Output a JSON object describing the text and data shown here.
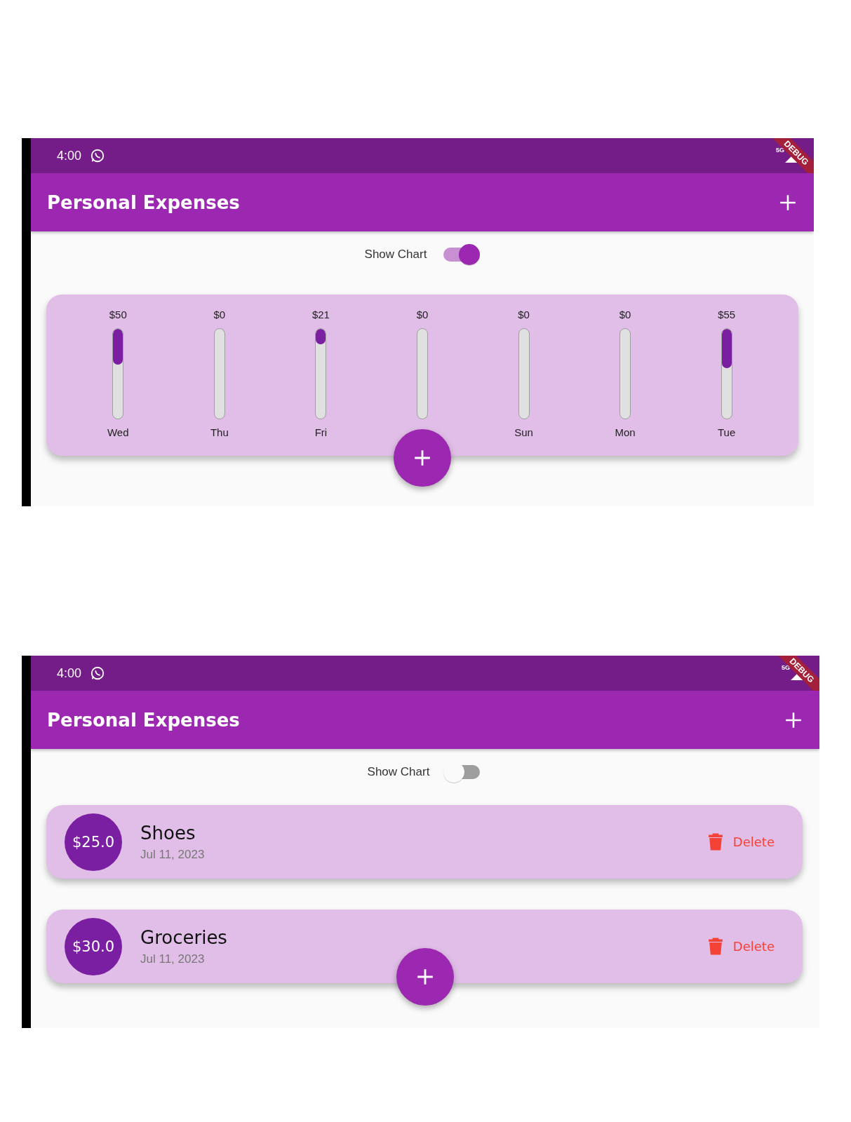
{
  "screens": [
    {
      "status_bar": {
        "time": "4:00",
        "network": "5G"
      },
      "debug_banner": "DEBUG",
      "app_bar": {
        "title": "Personal Expenses"
      },
      "show_chart": {
        "label": "Show Chart",
        "on": true
      },
      "chart": {
        "bars": [
          {
            "amount": "$50",
            "day": "Wed",
            "level": 0.4
          },
          {
            "amount": "$0",
            "day": "Thu"
          },
          {
            "amount": "$21",
            "day": "Fri",
            "level": 0.17
          },
          {
            "amount": "$0"
          },
          {
            "amount": "$0",
            "day": "Sun"
          },
          {
            "amount": "$0",
            "day": "Mon"
          },
          {
            "amount": "$55",
            "day": "Tue",
            "level": 0.44
          }
        ]
      }
    },
    {
      "status_bar": {
        "time": "4:00",
        "network": "5G"
      },
      "debug_banner": "DEBUG",
      "app_bar": {
        "title": "Personal Expenses"
      },
      "show_chart": {
        "label": "Show Chart",
        "on": false
      },
      "transactions": [
        {
          "amount": "$25.0",
          "title": "Shoes",
          "date": "Jul 11, 2023",
          "action": "Delete"
        },
        {
          "amount": "$30.0",
          "title": "Groceries",
          "date": "Jul 11, 2023",
          "action": "Delete"
        }
      ]
    }
  ]
}
